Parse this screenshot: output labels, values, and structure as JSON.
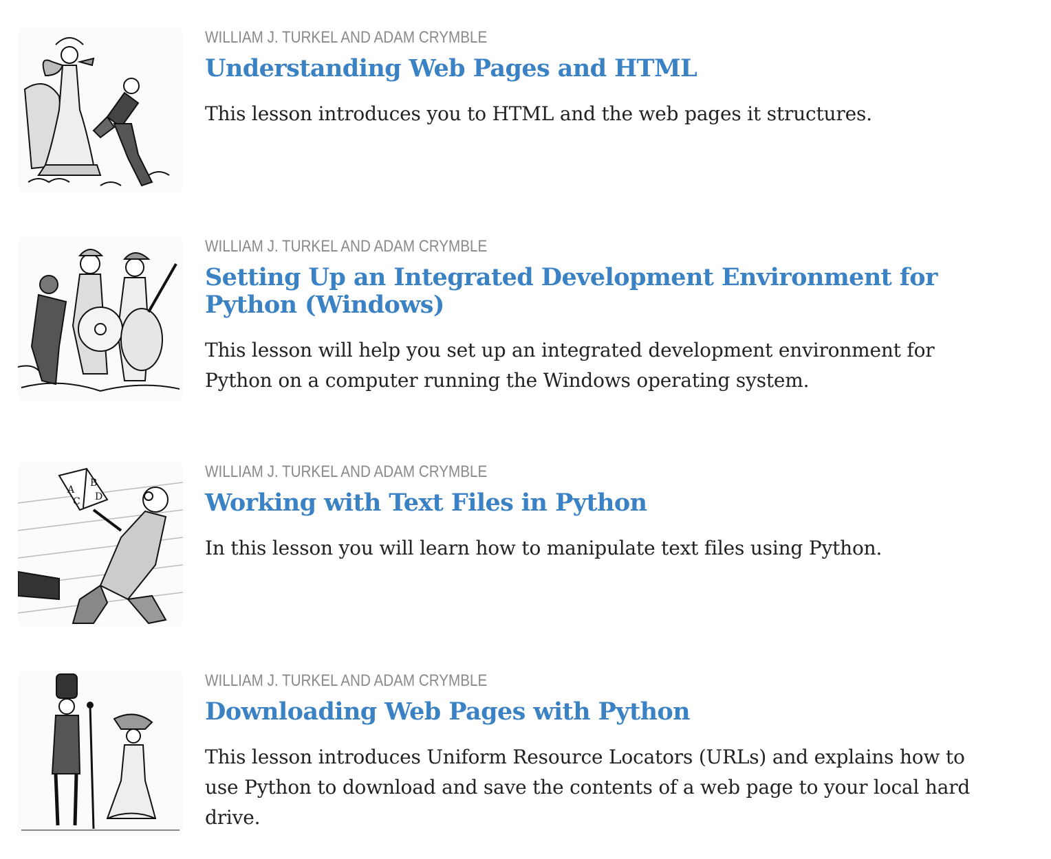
{
  "lessons": [
    {
      "author": "WILLIAM J. TURKEL AND ADAM CRYMBLE",
      "title": "Understanding Web Pages and HTML",
      "abstract": "This lesson introduces you to HTML and the web pages it structures.",
      "image_icon": "engraving-lady-with-fan-and-kneeling-man"
    },
    {
      "author": "WILLIAM J. TURKEL AND ADAM CRYMBLE",
      "title": "Setting Up an Integrated Development Environment for Python (Windows)",
      "abstract": "This lesson will help you set up an integrated development environment for Python on a computer running the Windows operating system.",
      "image_icon": "engraving-street-musicians"
    },
    {
      "author": "WILLIAM J. TURKEL AND ADAM CRYMBLE",
      "title": "Working with Text Files in Python",
      "abstract": "In this lesson you will learn how to manipulate text files using Python.",
      "image_icon": "engraving-man-reading-abcd-book"
    },
    {
      "author": "WILLIAM J. TURKEL AND ADAM CRYMBLE",
      "title": "Downloading Web Pages with Python",
      "abstract": "This lesson introduces Uniform Resource Locators (URLs) and explains how to use Python to download and save the contents of a web page to your local hard drive.",
      "image_icon": "engraving-soldier-and-lady"
    }
  ],
  "colors": {
    "author": "#8a8a8a",
    "title": "#3b82c4",
    "abstract": "#222222"
  }
}
